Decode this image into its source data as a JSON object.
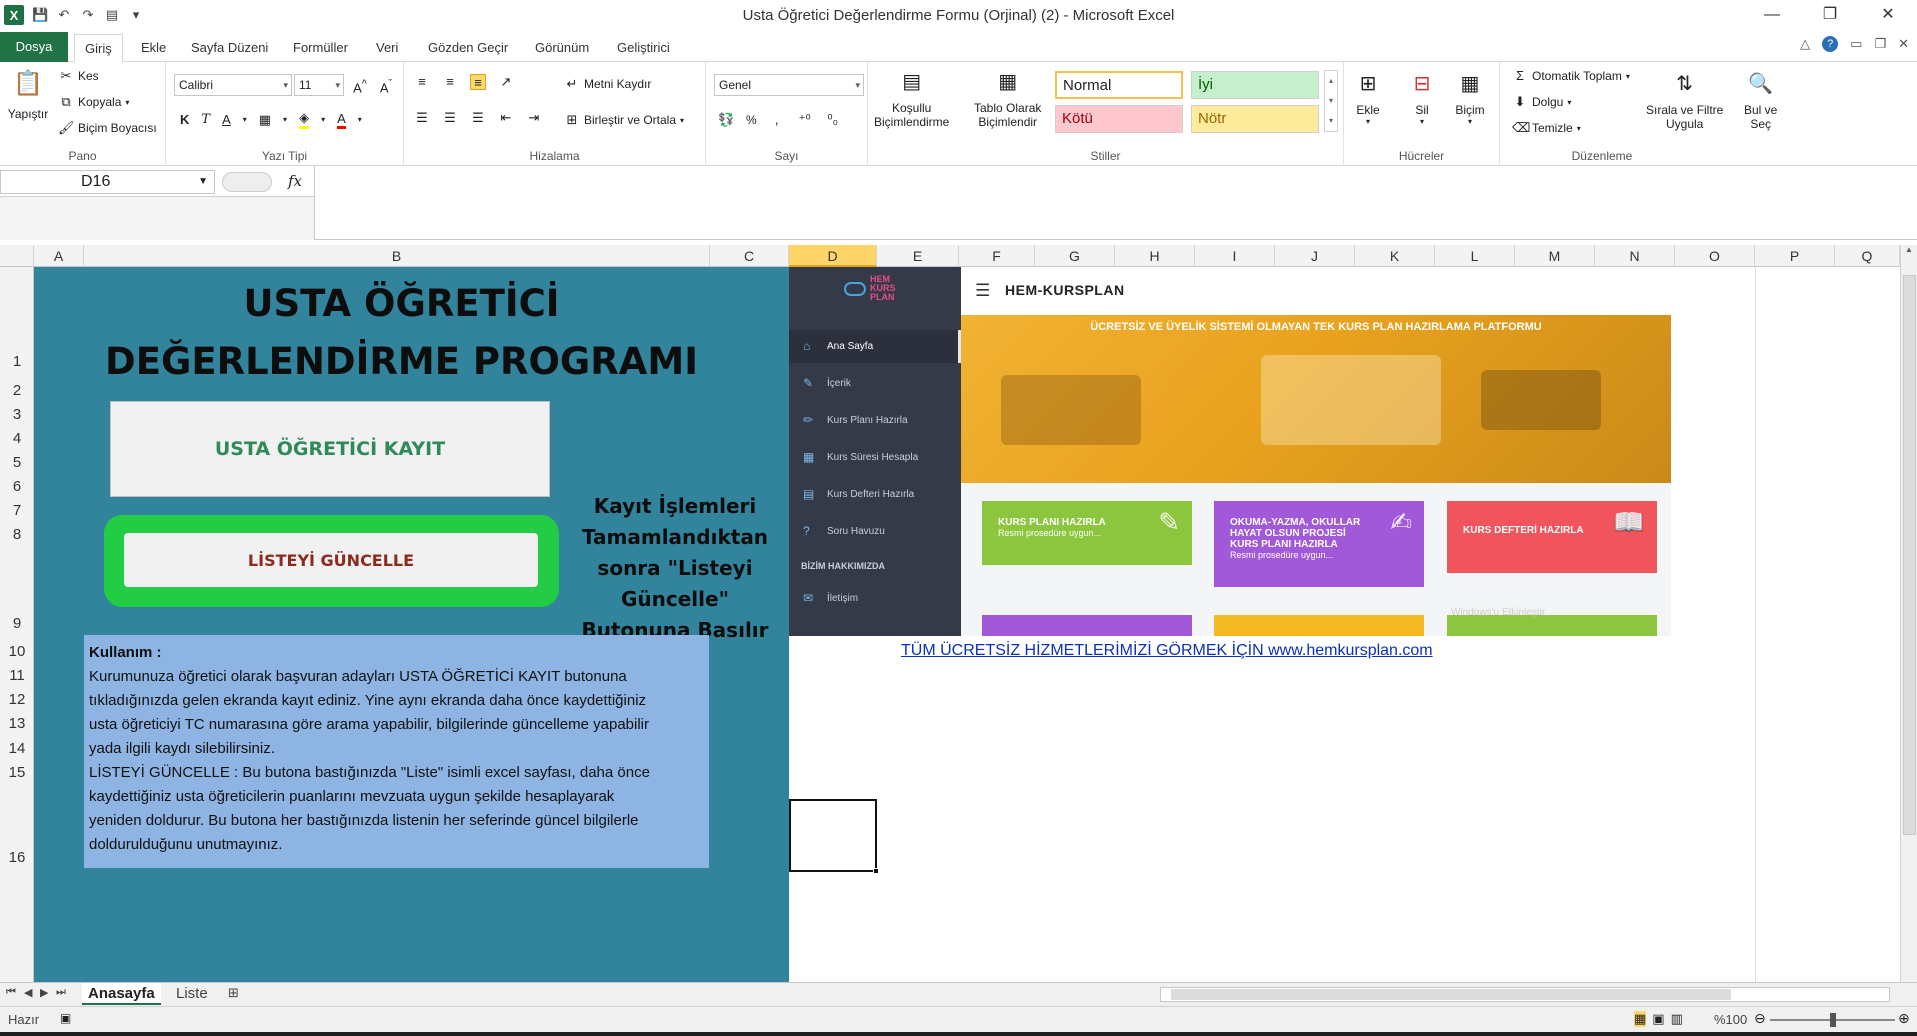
{
  "window": {
    "title": "Usta Öğretici Değerlendirme Formu (Orjinal) (2)  -  Microsoft Excel",
    "controls": [
      "—",
      "❐",
      "✕"
    ]
  },
  "tabs": {
    "file": "Dosya",
    "items": [
      "Giriş",
      "Ekle",
      "Sayfa Düzeni",
      "Formüller",
      "Veri",
      "Gözden Geçir",
      "Görünüm",
      "Geliştirici"
    ],
    "active": "Giriş"
  },
  "ribbon": {
    "clipboard": {
      "paste": "Yapıştır",
      "cut": "Kes",
      "copy": "Kopyala",
      "format_painter": "Biçim Boyacısı",
      "label": "Pano"
    },
    "font": {
      "name": "Calibri",
      "size": "11",
      "label": "Yazı Tipi"
    },
    "alignment": {
      "wrap": "Metni Kaydır",
      "merge": "Birleştir ve Ortala",
      "label": "Hizalama"
    },
    "number": {
      "format": "Genel",
      "percent": "%",
      "label": "Sayı"
    },
    "styles": {
      "conditional": [
        "Koşullu",
        "Biçimlendirme"
      ],
      "table": [
        "Tablo Olarak",
        "Biçimlendir"
      ],
      "cells": [
        {
          "name": "Normal",
          "bg": "#ffffff",
          "fg": "#000000"
        },
        {
          "name": "İyi",
          "bg": "#c6efce",
          "fg": "#006100"
        },
        {
          "name": "Kötü",
          "bg": "#ffc7ce",
          "fg": "#9c0006"
        },
        {
          "name": "Nötr",
          "bg": "#ffeb9c",
          "fg": "#9c6500"
        }
      ],
      "label": "Stiller"
    },
    "cells": {
      "insert": "Ekle",
      "delete": "Sil",
      "format": "Biçim",
      "label": "Hücreler"
    },
    "editing": {
      "autosum": "Otomatik Toplam",
      "fill": "Dolgu",
      "clear": "Temizle",
      "sort": [
        "Sırala ve Filtre",
        "Uygula"
      ],
      "find": [
        "Bul ve",
        "Seç"
      ],
      "label": "Düzenleme"
    }
  },
  "formula_bar": {
    "name_box": "D16",
    "fx": "fx",
    "value": ""
  },
  "columns": [
    "A",
    "B",
    "C",
    "D",
    "E",
    "F",
    "G",
    "H",
    "I",
    "J",
    "K",
    "L",
    "M",
    "N",
    "O",
    "P",
    "Q"
  ],
  "selected_column": "D",
  "rows": [
    "1",
    "2",
    "3",
    "4",
    "5",
    "6",
    "7",
    "8",
    "9",
    "10",
    "11",
    "12",
    "13",
    "14",
    "15",
    "16"
  ],
  "sheet": {
    "title_line1": "USTA ÖĞRETİCİ",
    "title_line2": "DEĞERLENDİRME PROGRAMI",
    "button_register": "USTA ÖĞRETİCİ KAYIT",
    "button_update": "LİSTEYİ GÜNCELLE",
    "note_lines": [
      "Kayıt İşlemleri",
      "Tamamlandıktan",
      "sonra \"Listeyi",
      "Güncelle\"",
      "Butonuna Basılır"
    ],
    "usage_head": "Kullanım :",
    "usage_lines": [
      "Kurumunuza öğretici olarak başvuran adayları USTA ÖĞRETİCİ KAYIT butonuna",
      "tıkladığınızda gelen ekranda kayıt ediniz. Yine aynı ekranda daha önce kaydettiğiniz",
      "usta öğreticiyi TC numarasına göre arama yapabilir, bilgilerinde güncelleme yapabilir",
      "yada ilgili kaydı silebilirsiniz.",
      "LİSTEYİ GÜNCELLE : Bu butona bastığınızda \"Liste\" isimli excel sayfası, daha önce",
      "kaydettiğiniz usta öğreticilerin puanlarını mevzuata uygun şekilde hesaplayarak",
      "yeniden doldurur. Bu butona her bastığınızda listenin her seferinde güncel bilgilerle",
      "doldurulduğunu unutmayınız."
    ],
    "link_text": "TÜM ÜCRETSİZ HİZMETLERİMİZİ GÖRMEK İÇİN www.hemkursplan.com"
  },
  "website": {
    "logo_lines": [
      "HEM",
      "KURS",
      "PLAN"
    ],
    "brand": "HEM-KURSPLAN",
    "banner": "ÜCRETSİZ VE ÜYELİK SİSTEMİ OLMAYAN TEK KURS PLAN HAZIRLAMA PLATFORMU",
    "nav": [
      {
        "label": "Ana Sayfa",
        "icon": "home-icon",
        "glyph": "⌂"
      },
      {
        "label": "İçerik",
        "icon": "content-icon",
        "glyph": "✎"
      },
      {
        "label": "Kurs Planı Hazırla",
        "icon": "pencil-icon",
        "glyph": "✏"
      },
      {
        "label": "Kurs Süresi Hesapla",
        "icon": "calculator-icon",
        "glyph": "▦"
      },
      {
        "label": "Kurs Defteri Hazırla",
        "icon": "notebook-icon",
        "glyph": "▤"
      },
      {
        "label": "Soru Havuzu",
        "icon": "question-icon",
        "glyph": "?"
      }
    ],
    "about": "BİZİM HAKKIMIZDA",
    "contact": {
      "label": "İletişim",
      "icon": "contact-icon",
      "glyph": "✉"
    },
    "cards": [
      {
        "title": "KURS PLANI HAZIRLA",
        "sub": "Resmi prosedüre uygun...",
        "color": "#8cc63f",
        "glyph": "✎"
      },
      {
        "title": "OKUMA-YAZMA, OKULLAR HAYAT OLSUN PROJESİ KURS PLANI HAZIRLA",
        "sub": "Resmi prosedüre uygun...",
        "color": "#a259d9",
        "glyph": "✍"
      },
      {
        "title": "KURS DEFTERİ HAZIRLA",
        "sub": "",
        "color": "#f0545c",
        "glyph": "📖"
      },
      {
        "title": "",
        "sub": "",
        "color": "#a259d9",
        "glyph": ""
      },
      {
        "title": "",
        "sub": "",
        "color": "#f5b921",
        "glyph": ""
      },
      {
        "title": "",
        "sub": "",
        "color": "#8cc63f",
        "glyph": ""
      }
    ],
    "watermark": "Windows'u Etkinleştir"
  },
  "sheet_tabs": {
    "items": [
      "Anasayfa",
      "Liste"
    ],
    "active": "Anasayfa"
  },
  "status": {
    "ready": "Hazır",
    "zoom": "%100"
  }
}
